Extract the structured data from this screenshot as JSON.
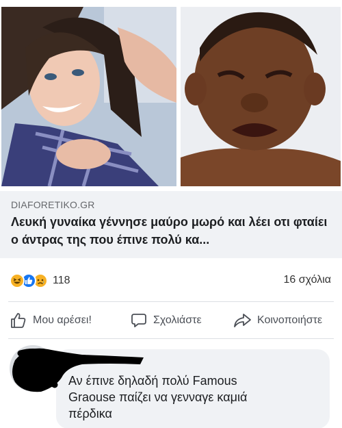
{
  "post": {
    "images": [
      {
        "name": "woman-selfie-photo"
      },
      {
        "name": "crying-baby-photo"
      }
    ],
    "link": {
      "domain": "DIAFORETIKO.GR",
      "headline": "Λευκή γυναίκα γέννησε μαύρο μωρό και λέει οτι φταίει ο άντρας της που έπινε πολύ κα..."
    },
    "stats": {
      "reaction_icons": [
        "haha-reaction-icon",
        "like-reaction-icon",
        "sad-reaction-icon"
      ],
      "reaction_count": "118",
      "comments_count": "16 σχόλια"
    },
    "actions": {
      "like_label": "Μου αρέσει!",
      "comment_label": "Σχολιάστε",
      "share_label": "Κοινοποιήστε"
    },
    "comment": {
      "text": "Αν έπινε δηλαδή πολύ Famous Graouse παίζει να γενναγε καμιά πέρδικα"
    }
  },
  "colors": {
    "link_box_bg": "#f0f2f5",
    "like_blue": "#1877f2",
    "reaction_yellow": "#f7b125",
    "secondary_text": "#65676b"
  }
}
